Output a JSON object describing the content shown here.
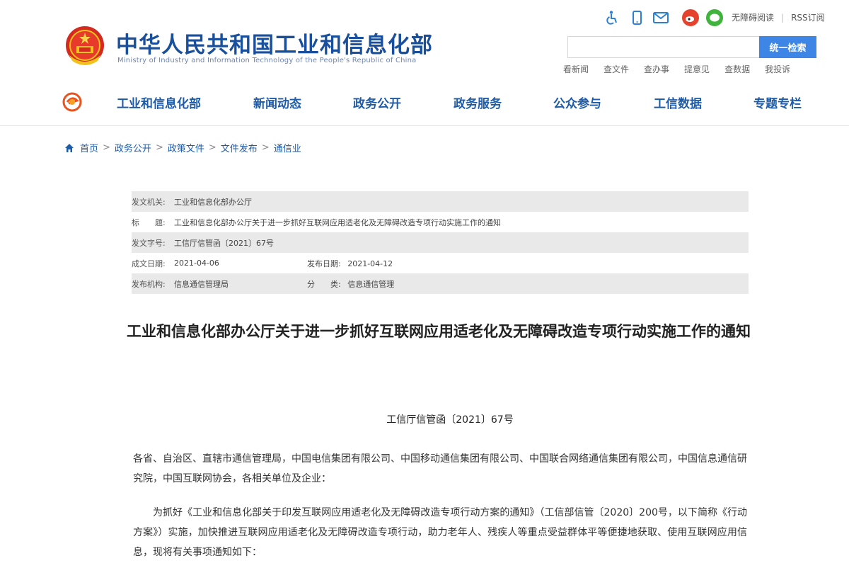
{
  "header": {
    "site_title": "中华人民共和国工业和信息化部",
    "site_subtitle": "Ministry of Industry and Information Technology of the People's Republic of China",
    "util_links": {
      "no_barrier": "无障碍阅读",
      "rss": "RSS订阅"
    },
    "search": {
      "placeholder": "",
      "button": "统一检索"
    },
    "quick_links": [
      "看新闻",
      "查文件",
      "查办事",
      "提意见",
      "查数据",
      "我投诉"
    ],
    "nav": [
      "工业和信息化部",
      "新闻动态",
      "政务公开",
      "政务服务",
      "公众参与",
      "工信数据",
      "专题专栏"
    ]
  },
  "breadcrumb": [
    "首页",
    "政务公开",
    "政策文件",
    "文件发布",
    "通信业"
  ],
  "meta": {
    "issuer_label": "发文机关:",
    "issuer": "工业和信息化部办公厅",
    "title_label": "标　　题:",
    "title": "工业和信息化部办公厅关于进一步抓好互联网应用适老化及无障碍改造专项行动实施工作的通知",
    "docno_label": "发文字号:",
    "docno": "工信厅信管函〔2021〕67号",
    "date_label": "成文日期:",
    "date": "2021-04-06",
    "pubdate_label": "发布日期:",
    "pubdate": "2021-04-12",
    "source_label": "发布机构:",
    "source": "信息通信管理局",
    "category_label": "分　　类:",
    "category": "信息通信管理"
  },
  "document": {
    "title": "工业和信息化部办公厅关于进一步抓好互联网应用适老化及无障碍改造专项行动实施工作的通知",
    "number": "工信厅信管函〔2021〕67号",
    "salutation": "各省、自治区、直辖市通信管理局，中国电信集团有限公司、中国移动通信集团有限公司、中国联合网络通信集团有限公司，中国信息通信研究院，中国互联网协会，各相关单位及企业：",
    "para1": "为抓好《工业和信息化部关于印发互联网应用适老化及无障碍改造专项行动方案的通知》（工信部信管〔2020〕200号，以下简称《行动方案》）实施，加快推进互联网应用适老化及无障碍改造专项行动，助力老年人、残疾人等重点受益群体平等便捷地获取、使用互联网应用信息，现将有关事项通知如下："
  },
  "colors": {
    "brand_blue": "#1a4f9c",
    "search_button": "#3d86e6",
    "row_shade": "#e9e9e9"
  }
}
